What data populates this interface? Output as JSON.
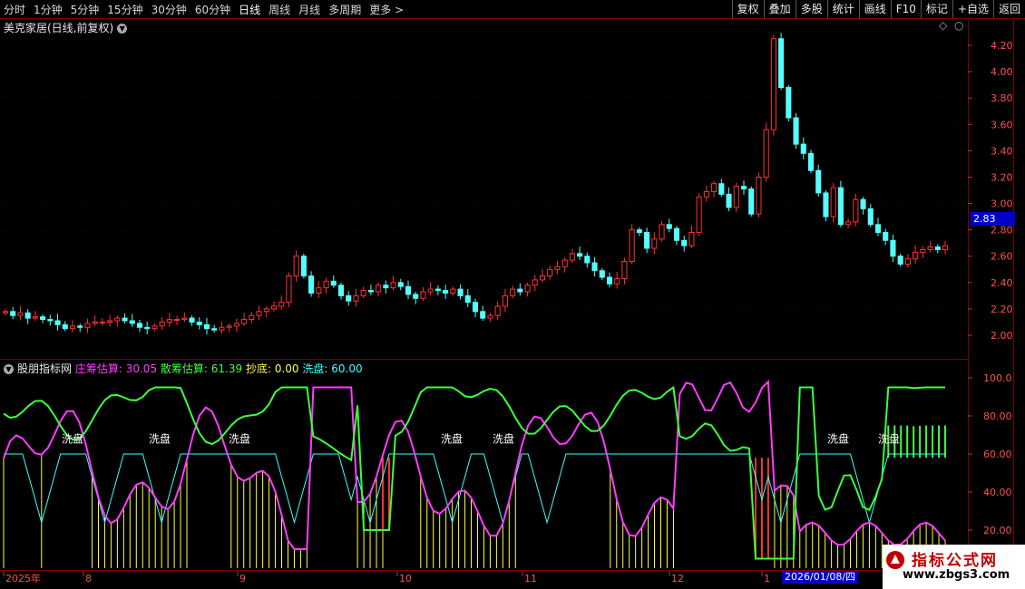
{
  "toolbar": {
    "periods": [
      "分时",
      "1分钟",
      "5分钟",
      "15分钟",
      "30分钟",
      "60分钟",
      "日线",
      "周线",
      "月线",
      "多周期",
      "更多 >"
    ],
    "active_period": "日线",
    "actions": [
      "复权",
      "叠加",
      "多股",
      "统计",
      "画线",
      "F10",
      "标记",
      "+自选",
      "返回"
    ]
  },
  "main_chart": {
    "title": "美克家居(日线,前复权)",
    "current_price_tag": "2.83",
    "price_axis_labels": [
      "4.20",
      "4.00",
      "3.80",
      "3.60",
      "3.40",
      "3.20",
      "3.00",
      "2.80",
      "2.60",
      "2.40",
      "2.20",
      "2.00"
    ],
    "colors": {
      "up": "#ff3232",
      "down": "#54ffff",
      "grid": "#7a0000"
    }
  },
  "indicator": {
    "name": "股朋指标网",
    "items": [
      {
        "label": "庄筹估算:",
        "value": "30.05",
        "color": "#ff3cff"
      },
      {
        "label": "散筹估算:",
        "value": "61.39",
        "color": "#3cff3c"
      },
      {
        "label": "抄底:",
        "value": "0.00",
        "color": "#ffff3c"
      },
      {
        "label": "洗盘:",
        "value": "60.00",
        "color": "#3cffff"
      }
    ],
    "axis_labels": [
      "100.0",
      "80.00",
      "60.00",
      "40.00",
      "20.00"
    ],
    "wash_label": "洗盘"
  },
  "time_axis": {
    "labels": [
      "2025年",
      "8",
      "9",
      "10",
      "11",
      "12",
      "1"
    ],
    "cursor_date": "2026/01/08/四"
  },
  "watermark": {
    "line1": "指标公式网",
    "line2": "www.zbgs3.com"
  },
  "chart_data": {
    "type": "candlestick",
    "title": "美克家居(日线,前复权)",
    "ylim": [
      1.9,
      4.3
    ],
    "ohlc_note": "approximate daily closes read from chart",
    "closes": [
      2.18,
      2.15,
      2.17,
      2.13,
      2.14,
      2.12,
      2.11,
      2.08,
      2.05,
      2.07,
      2.06,
      2.09,
      2.1,
      2.1,
      2.11,
      2.13,
      2.11,
      2.09,
      2.06,
      2.05,
      2.07,
      2.1,
      2.12,
      2.12,
      2.13,
      2.1,
      2.08,
      2.05,
      2.04,
      2.06,
      2.07,
      2.09,
      2.12,
      2.15,
      2.18,
      2.2,
      2.22,
      2.25,
      2.45,
      2.6,
      2.45,
      2.32,
      2.36,
      2.41,
      2.38,
      2.3,
      2.26,
      2.3,
      2.34,
      2.33,
      2.38,
      2.36,
      2.4,
      2.37,
      2.31,
      2.28,
      2.33,
      2.35,
      2.34,
      2.32,
      2.35,
      2.3,
      2.25,
      2.18,
      2.13,
      2.15,
      2.22,
      2.3,
      2.35,
      2.33,
      2.38,
      2.42,
      2.45,
      2.5,
      2.52,
      2.57,
      2.62,
      2.6,
      2.55,
      2.49,
      2.44,
      2.39,
      2.43,
      2.56,
      2.8,
      2.78,
      2.66,
      2.73,
      2.84,
      2.81,
      2.72,
      2.68,
      2.78,
      3.05,
      3.09,
      3.15,
      3.07,
      2.97,
      3.13,
      3.11,
      2.92,
      3.2,
      3.56,
      4.25,
      3.88,
      3.65,
      3.45,
      3.38,
      3.25,
      3.08,
      2.9,
      3.12,
      2.84,
      2.86,
      3.03,
      2.96,
      2.84,
      2.78,
      2.72,
      2.6,
      2.54,
      2.58,
      2.63,
      2.65,
      2.67,
      2.65,
      2.68
    ],
    "indicator_series": [
      {
        "name": "庄筹估算",
        "color": "#ff3cff"
      },
      {
        "name": "散筹估算",
        "color": "#3cff3c"
      },
      {
        "name": "抄底",
        "color": "#ffff3c"
      },
      {
        "name": "洗盘",
        "color": "#3cffff"
      }
    ],
    "indicator_ylim": [
      0,
      100
    ]
  }
}
